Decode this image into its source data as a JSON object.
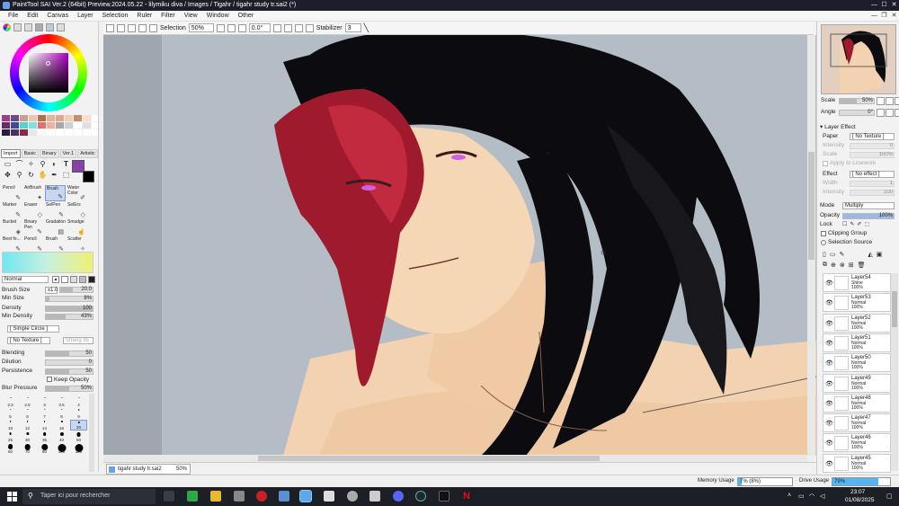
{
  "titlebar": {
    "title": "PaintTool SAI Ver.2 (64bit) Preview.2024.05.22 - lilymiku diva / Images / Tigahr / tigahr study tr.sai2 (*)"
  },
  "menu": [
    "File",
    "Edit",
    "Canvas",
    "Layer",
    "Selection",
    "Ruler",
    "Filter",
    "View",
    "Window",
    "Other"
  ],
  "toolbar": {
    "selection_label": "Selection",
    "selection_value": "50%",
    "angle_value": "0.0°",
    "stabilizer_label": "Stabilizer",
    "stabilizer_value": "3"
  },
  "tool_tabs": [
    "Import",
    "Basic",
    "Binary",
    "Ver.1",
    "Artistic"
  ],
  "tools": [
    {
      "label": "Pencil",
      "glyph": "✎"
    },
    {
      "label": "AirBrush",
      "glyph": "✦"
    },
    {
      "label": "Brush",
      "glyph": "✎"
    },
    {
      "label": "Water Color",
      "glyph": "✐"
    },
    {
      "label": "Marker",
      "glyph": "✎"
    },
    {
      "label": "Eraser",
      "glyph": "◇"
    },
    {
      "label": "SelPen",
      "glyph": "✎"
    },
    {
      "label": "SelErs",
      "glyph": "◇"
    },
    {
      "label": "Bucket",
      "glyph": "◈"
    },
    {
      "label": "Binary Pen",
      "glyph": "✎"
    },
    {
      "label": "Gradation",
      "glyph": "▤"
    },
    {
      "label": "Smudge",
      "glyph": "☝"
    },
    {
      "label": "Best fo...",
      "glyph": "✎"
    },
    {
      "label": "Pencil",
      "glyph": "✎"
    },
    {
      "label": "Brush",
      "glyph": "✎"
    },
    {
      "label": "Scatter",
      "glyph": "✧"
    }
  ],
  "brush": {
    "blend_mode": "Normal",
    "size_label": "Brush Size",
    "size_multiplier": "x1.0",
    "size_value": "20.0",
    "min_size_label": "Min Size",
    "min_size_value": "8%",
    "density_label": "Density",
    "density_value": "100",
    "min_density_label": "Min Density",
    "min_density_value": "43%",
    "shape": "[ Simple Circle ]",
    "texture": "[ No Texture ]",
    "texture_strength": "Streng 95",
    "blending_label": "Blending",
    "blending_value": "50",
    "dilution_label": "Dilution",
    "dilution_value": "0",
    "persistence_label": "Persistence",
    "persistence_value": "50",
    "keep_opacity": "Keep Opacity",
    "blur_label": "Blur Pressure",
    "blur_value": "50%"
  },
  "brush_sizes": [
    "2.3",
    "2.6",
    "3",
    "3.5",
    "4",
    "5",
    "6",
    "7",
    "8",
    "9",
    "10",
    "12",
    "14",
    "16",
    "20",
    "25",
    "30",
    "35",
    "40",
    "50",
    "60",
    "70",
    "80",
    "100",
    "120"
  ],
  "navigator": {
    "scale_label": "Scale",
    "scale_value": "50%",
    "angle_label": "Angle",
    "angle_value": "0°"
  },
  "layer_effect": {
    "title": "Layer Effect",
    "paper_label": "Paper",
    "paper_value": "[ No Texture ]",
    "intensity_label": "Intensity",
    "intensity_value": "0",
    "scale_label": "Scale",
    "scale_value": "100%",
    "apply_lineart": "Apply to Linework",
    "effect_label": "Effect",
    "effect_value": "[ No effect ]",
    "width_label": "Width",
    "width_value": "1",
    "intensity2_label": "Intensity",
    "intensity2_value": "100"
  },
  "layer_props": {
    "mode_label": "Mode",
    "mode_value": "Multiply",
    "opacity_label": "Opacity",
    "opacity_value": "100%",
    "lock_label": "Lock",
    "clipping_group": "Clipping Group",
    "selection_source": "Selection Source"
  },
  "layers": [
    {
      "name": "Layer54",
      "mode": "Shine",
      "opacity": "100%"
    },
    {
      "name": "Layer53",
      "mode": "Normal",
      "opacity": "100%"
    },
    {
      "name": "Layer52",
      "mode": "Normal",
      "opacity": "100%"
    },
    {
      "name": "Layer51",
      "mode": "Normal",
      "opacity": "100%"
    },
    {
      "name": "Layer50",
      "mode": "Normal",
      "opacity": "100%"
    },
    {
      "name": "Layer49",
      "mode": "Normal",
      "opacity": "100%"
    },
    {
      "name": "Layer48",
      "mode": "Normal",
      "opacity": "100%"
    },
    {
      "name": "Layer47",
      "mode": "Normal",
      "opacity": "100%"
    },
    {
      "name": "Layer46",
      "mode": "Normal",
      "opacity": "100%"
    },
    {
      "name": "Layer45",
      "mode": "Normal",
      "opacity": "100%"
    }
  ],
  "doc_tab": {
    "name": "tigahr study tr.sai2",
    "zoom": "50%"
  },
  "status": {
    "memory_label": "Memory Usage",
    "memory_value": "7% (8%)",
    "memory_fraction": 0.07,
    "drive_label": "Drive Usage",
    "drive_value": "79%",
    "drive_fraction": 0.79
  },
  "taskbar": {
    "search_placeholder": "Taper ici pour rechercher",
    "time": "23:07",
    "date": "01/08/2025"
  },
  "colors": {
    "accent_purple": "#8b3fa8",
    "hair_red": "#a01a2e",
    "hair_black": "#0c0c10",
    "skin": "#f2d2b0",
    "canvas_bg": "#9fa6ae"
  }
}
